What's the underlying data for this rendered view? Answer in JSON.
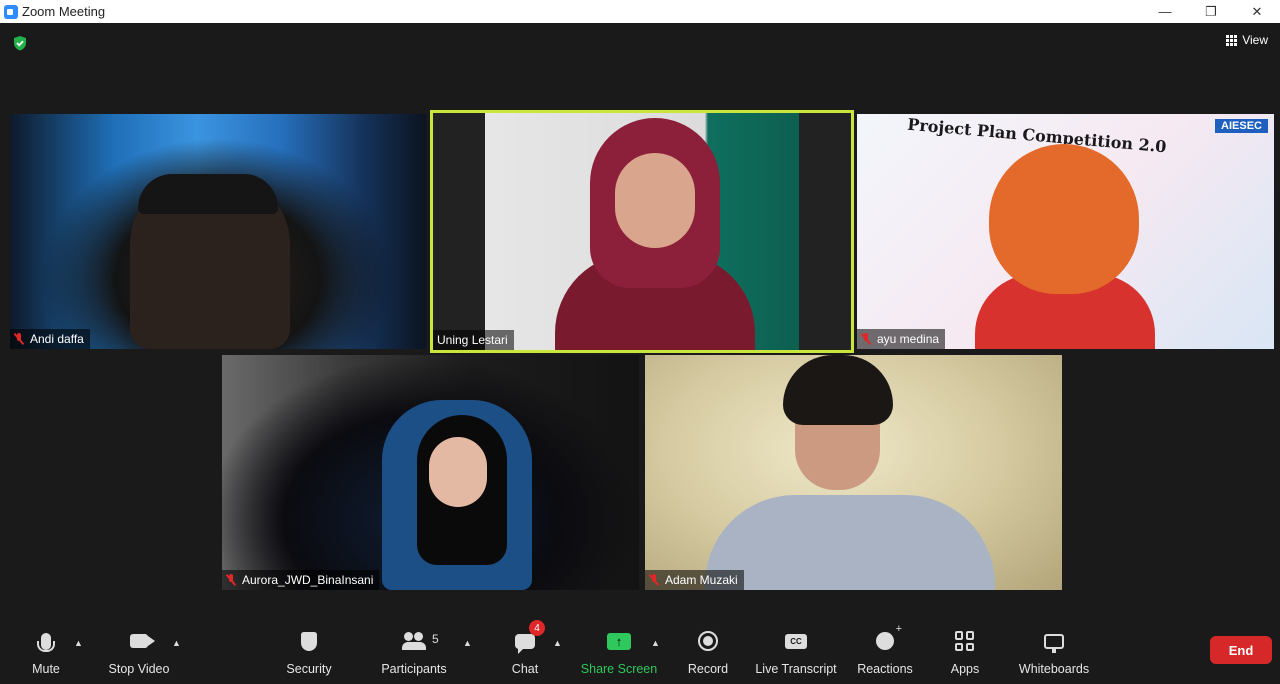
{
  "window": {
    "title": "Zoom Meeting",
    "minimize": "—",
    "restore": "❐",
    "close": "✕"
  },
  "header": {
    "view_label": "View"
  },
  "participants": [
    {
      "name": "Andi daffa",
      "muted": true
    },
    {
      "name": "Uning Lestari",
      "muted": false,
      "active_speaker": true
    },
    {
      "name": "ayu medina",
      "muted": true
    },
    {
      "name": "Aurora_JWD_BinaInsani",
      "muted": true
    },
    {
      "name": "Adam Muzaki",
      "muted": true
    }
  ],
  "background_texts": {
    "ayu_banner": "Project Plan Competition 2.0",
    "ayu_badge": "AIESEC"
  },
  "toolbar": {
    "mute": "Mute",
    "stop_video": "Stop Video",
    "security": "Security",
    "participants": "Participants",
    "participants_count": "5",
    "chat": "Chat",
    "chat_badge": "4",
    "share_screen": "Share Screen",
    "record": "Record",
    "live_transcript": "Live Transcript",
    "cc_icon_text": "CC",
    "reactions": "Reactions",
    "apps": "Apps",
    "whiteboards": "Whiteboards",
    "end": "End"
  },
  "colors": {
    "active_speaker_border": "#c8e63c",
    "share_green": "#2ec85c",
    "end_red": "#d62828",
    "muted_red": "#e02828"
  }
}
